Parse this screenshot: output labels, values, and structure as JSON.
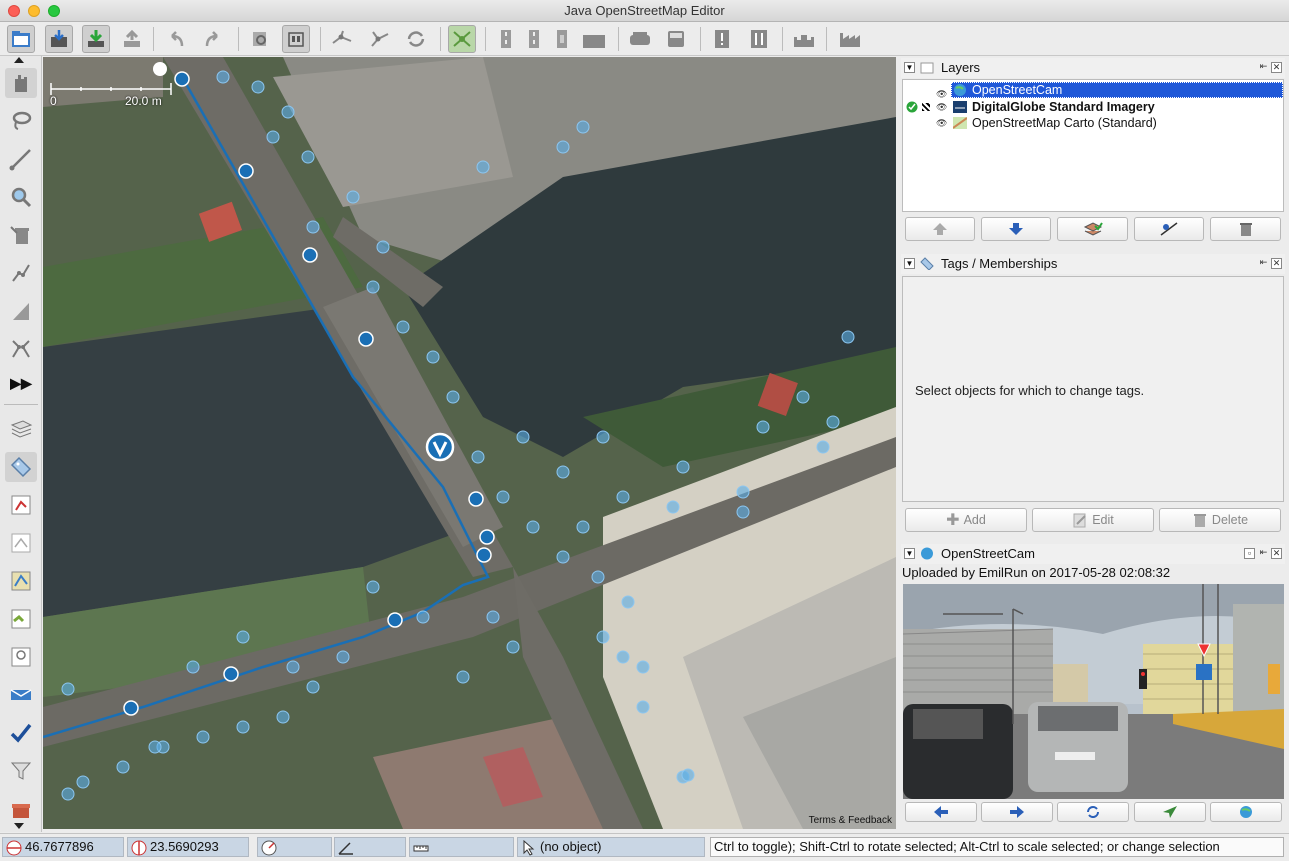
{
  "window": {
    "title": "Java OpenStreetMap Editor"
  },
  "map": {
    "scale_start": "0",
    "scale_end": "20.0 m",
    "attribution": "Terms & Feedback"
  },
  "layers_panel": {
    "title": "Layers",
    "items": [
      {
        "name": "OpenStreetCam",
        "selected": true,
        "active": false
      },
      {
        "name": "DigitalGlobe Standard Imagery",
        "selected": false,
        "active": true
      },
      {
        "name": "OpenStreetMap Carto (Standard)",
        "selected": false,
        "active": false
      }
    ],
    "buttons": [
      "move-up",
      "move-down",
      "merge",
      "change-opacity",
      "delete"
    ]
  },
  "tags_panel": {
    "title": "Tags / Memberships",
    "empty_message": "Select objects for which to change tags.",
    "add_label": "Add",
    "edit_label": "Edit",
    "delete_label": "Delete"
  },
  "osc_panel": {
    "title": "OpenStreetCam",
    "uploaded_by": "Uploaded by EmilRun  on 2017-05-28 02:08:32",
    "buttons": [
      "previous-photo",
      "next-photo",
      "refresh",
      "location",
      "web-page"
    ]
  },
  "status_bar": {
    "latitude": "46.7677896",
    "longitude": "23.5690293",
    "heading": "",
    "angle": "",
    "distance": "",
    "object": "(no object)",
    "hint": "Ctrl to toggle); Shift-Ctrl to rotate selected; Alt-Ctrl to scale selected; or change selection"
  },
  "colors": {
    "accent_selection": "#1f58d8",
    "track_blue": "#1a6fb5",
    "photo_marker": "#5aaee6",
    "status_field": "#c9d6e4"
  }
}
